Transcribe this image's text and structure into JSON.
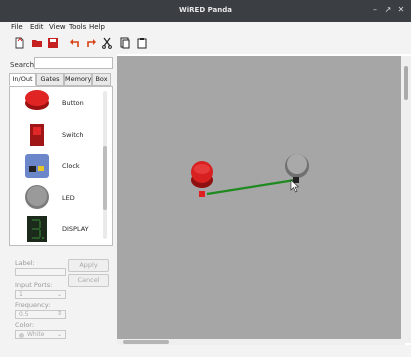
{
  "window": {
    "title": "WiRED Panda",
    "controls": [
      "–",
      "↗",
      "✕"
    ]
  },
  "menu": [
    "File",
    "Edit",
    "View",
    "Tools",
    "Help"
  ],
  "toolbar": {
    "icons": [
      "new-file-icon",
      "open-folder-icon",
      "save-icon",
      "undo-icon",
      "redo-icon",
      "cut-icon",
      "copy-icon",
      "paste-icon"
    ]
  },
  "search": {
    "label": "Search:",
    "value": ""
  },
  "tabs": [
    "In/Out",
    "Gates",
    "Memory",
    "Box"
  ],
  "active_tab": "In/Out",
  "palette": [
    {
      "label": "Button",
      "icon": "button-icon"
    },
    {
      "label": "Switch",
      "icon": "switch-icon"
    },
    {
      "label": "Clock",
      "icon": "clock-icon"
    },
    {
      "label": "LED",
      "icon": "led-icon"
    },
    {
      "label": "DISPLAY",
      "icon": "display-icon"
    }
  ],
  "properties": {
    "label_label": "Label:",
    "label_value": "",
    "apply": "Apply",
    "cancel": "Cancel",
    "input_ports_label": "Input Ports:",
    "input_ports_value": "1",
    "frequency_label": "Frequency:",
    "frequency_value": "0.5",
    "color_label": "Color:",
    "color_value": "White"
  },
  "colors": {
    "wire": "#1f8a1f",
    "canvas": "#a6a6a6",
    "button_red": "#d32020",
    "led_off": "#8a8a8a"
  }
}
